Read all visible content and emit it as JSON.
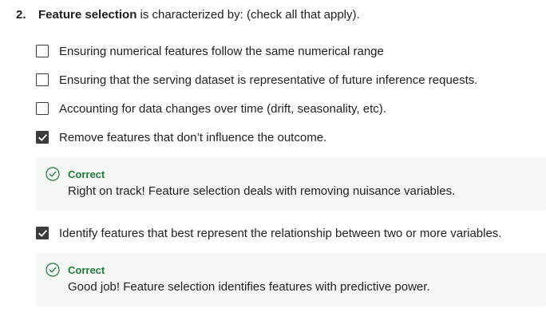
{
  "question": {
    "number": "2.",
    "bold_text": "Feature selection",
    "rest_text": " is characterized by: (check all that apply)."
  },
  "options": [
    {
      "label": "Ensuring numerical features follow the same numerical range",
      "checked": false
    },
    {
      "label": "Ensuring that the serving dataset is representative of future inference requests.",
      "checked": false
    },
    {
      "label": "Accounting for data changes over time (drift, seasonality, etc).",
      "checked": false
    },
    {
      "label": "Remove features that don’t influence the outcome.",
      "checked": true,
      "feedback": {
        "status": "Correct",
        "message": "Right on track! Feature selection deals with removing nuisance variables."
      }
    },
    {
      "label": "Identify features that best represent the relationship between two or more variables.",
      "checked": true,
      "feedback": {
        "status": "Correct",
        "message": "Good job! Feature selection identifies features with predictive power."
      }
    }
  ],
  "colors": {
    "correct": "#1e7a3a",
    "feedback_bg": "#f4f7f4",
    "checkbox": "#3b3b3b"
  },
  "icons": {
    "checked": "checkmark-icon",
    "correct": "check-circle-icon"
  }
}
